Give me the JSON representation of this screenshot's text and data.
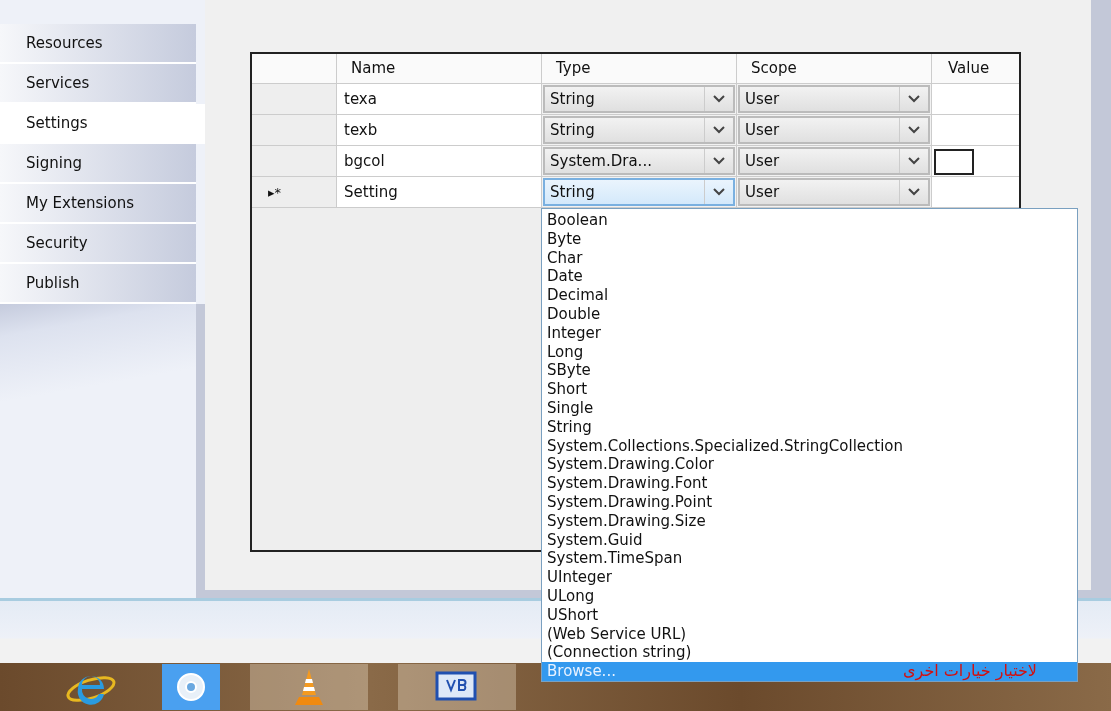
{
  "sidebar": {
    "items": [
      {
        "label": "Resources",
        "selected": false
      },
      {
        "label": "Services",
        "selected": false
      },
      {
        "label": "Settings",
        "selected": true
      },
      {
        "label": "Signing",
        "selected": false
      },
      {
        "label": "My Extensions",
        "selected": false
      },
      {
        "label": "Security",
        "selected": false
      },
      {
        "label": "Publish",
        "selected": false
      }
    ]
  },
  "settings_grid": {
    "columns": [
      "Name",
      "Type",
      "Scope",
      "Value"
    ],
    "rows": [
      {
        "indicator": "",
        "name": "texa",
        "type": "String",
        "type_focused": false,
        "scope": "User",
        "swatch": false
      },
      {
        "indicator": "",
        "name": "texb",
        "type": "String",
        "type_focused": false,
        "scope": "User",
        "swatch": false
      },
      {
        "indicator": "",
        "name": "bgcol",
        "type": "System.Dra...",
        "type_focused": false,
        "scope": "User",
        "swatch": true
      },
      {
        "indicator": "▸*",
        "name": "Setting",
        "type": "String",
        "type_focused": true,
        "scope": "User",
        "swatch": false
      }
    ]
  },
  "type_dropdown": {
    "items": [
      {
        "label": "Boolean",
        "selected": false
      },
      {
        "label": "Byte",
        "selected": false
      },
      {
        "label": "Char",
        "selected": false
      },
      {
        "label": "Date",
        "selected": false
      },
      {
        "label": "Decimal",
        "selected": false
      },
      {
        "label": "Double",
        "selected": false
      },
      {
        "label": "Integer",
        "selected": false
      },
      {
        "label": "Long",
        "selected": false
      },
      {
        "label": "SByte",
        "selected": false
      },
      {
        "label": "Short",
        "selected": false
      },
      {
        "label": "Single",
        "selected": false
      },
      {
        "label": "String",
        "selected": false
      },
      {
        "label": "System.Collections.Specialized.StringCollection",
        "selected": false
      },
      {
        "label": "System.Drawing.Color",
        "selected": false
      },
      {
        "label": "System.Drawing.Font",
        "selected": false
      },
      {
        "label": "System.Drawing.Point",
        "selected": false
      },
      {
        "label": "System.Drawing.Size",
        "selected": false
      },
      {
        "label": "System.Guid",
        "selected": false
      },
      {
        "label": "System.TimeSpan",
        "selected": false
      },
      {
        "label": "UInteger",
        "selected": false
      },
      {
        "label": "ULong",
        "selected": false
      },
      {
        "label": "UShort",
        "selected": false
      },
      {
        "label": "(Web Service URL)",
        "selected": false
      },
      {
        "label": "(Connection string)",
        "selected": false
      },
      {
        "label": "Browse...",
        "selected": true
      }
    ],
    "annotation": "لاختيار خيارات اخرى"
  },
  "taskbar": {
    "apps": [
      {
        "kind": "ie"
      },
      {
        "kind": "chrome"
      },
      {
        "kind": "vlc"
      },
      {
        "kind": "vb"
      }
    ]
  }
}
